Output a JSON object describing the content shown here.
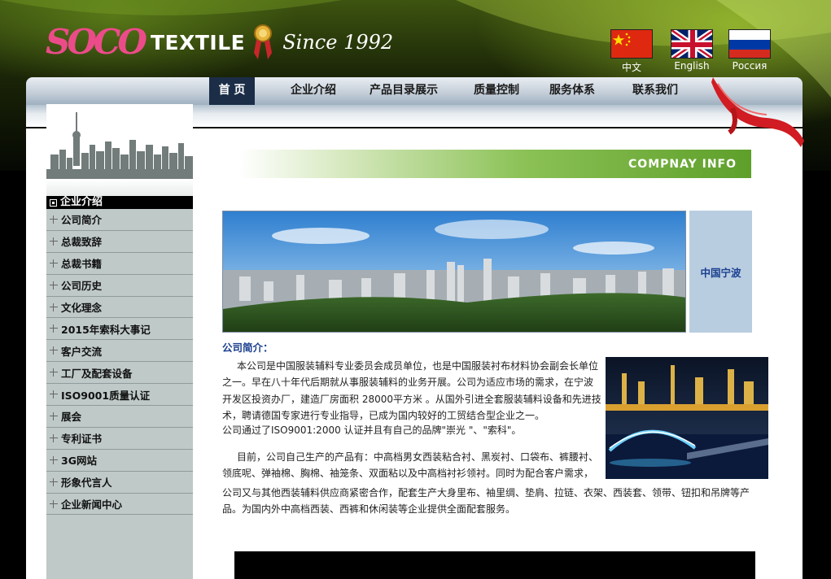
{
  "logo": {
    "brand_text": "TEXTILE",
    "since_text": "Since 1992",
    "mark_letters": "SOCO"
  },
  "languages": [
    {
      "label": "中文",
      "flag": "china-flag-icon"
    },
    {
      "label": "English",
      "flag": "uk-flag-icon"
    },
    {
      "label": "Россия",
      "flag": "russia-flag-icon"
    }
  ],
  "nav": {
    "items": [
      {
        "label": "首 页",
        "active": true
      },
      {
        "label": "企业介绍",
        "active": false
      },
      {
        "label": "产品目录展示",
        "active": false
      },
      {
        "label": "质量控制",
        "active": false
      },
      {
        "label": "服务体系",
        "active": false
      },
      {
        "label": "联系我们",
        "active": false
      }
    ]
  },
  "sidebar": {
    "title": "企业介绍",
    "items": [
      {
        "label": "公司简介"
      },
      {
        "label": "总裁致辞"
      },
      {
        "label": "总裁书籍"
      },
      {
        "label": "公司历史"
      },
      {
        "label": "文化理念"
      },
      {
        "label": "2015年索科大事记"
      },
      {
        "label": "客户交流"
      },
      {
        "label": "工厂及配套设备"
      },
      {
        "label": "ISO9001质量认证"
      },
      {
        "label": "展会"
      },
      {
        "label": "专利证书"
      },
      {
        "label": "3G网站"
      },
      {
        "label": "形象代言人"
      },
      {
        "label": "企业新闻中心"
      }
    ]
  },
  "main": {
    "banner": "COMPNAY INFO",
    "city_label": "中国宁波",
    "section_title": "公司简介：",
    "para1": "本公司是中国服装辅料专业委员会成员单位，也是中国服装衬布材料协会副会长单位之一。早在八十年代后期就从事服装辅料的业务开展。公司为适应市场的需求，在宁波开发区投资办厂，建造厂房面积 28000平方米 。从国外引进全套服装辅料设备和先进技术，聘请德国专家进行专业指导，已成为国内较好的工贸结合型企业之一。",
    "para1b": "公司通过了ISO9001:2000 认证并且有自己的品牌\"崇光 \"、\"索科\"。",
    "para2": "目前，公司自己生产的产品有：中高档男女西装粘合衬、黑炭衬、口袋布、裤腰衬、领底呢、弹袖棉、胸棉、袖笼条、双面粘以及中高档衬衫领衬。同时为配合客户需求，",
    "para3": "公司又与其他西装辅料供应商紧密合作，配套生产大身里布、袖里绸、垫肩、拉链、衣架、西装套、领带、钮扣和吊牌等产品。为国内外中高档西装、西裤和休闲装等企业提供全面配套服务。"
  }
}
